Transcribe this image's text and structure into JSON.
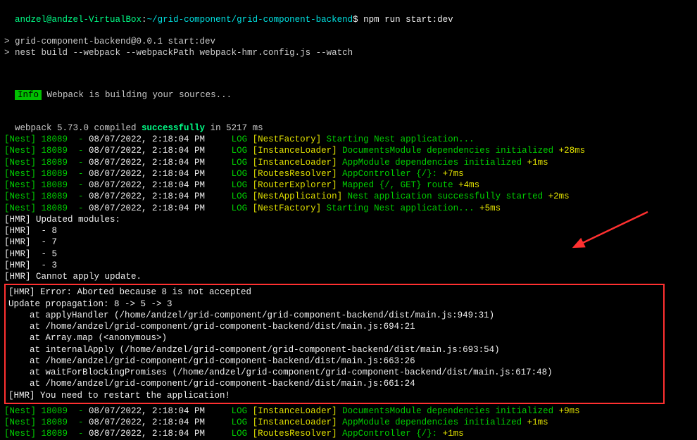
{
  "prompt": {
    "user": "andzel@andzel-VirtualBox",
    "sep": ":",
    "path": "~/grid-component/grid-component-backend",
    "dollar": "$",
    "cmd": "npm run start:dev"
  },
  "npm": [
    "> grid-component-backend@0.0.1 start:dev",
    "> nest build --webpack --webpackPath webpack-hmr.config.js --watch"
  ],
  "infoLabel": "Info",
  "infoMsg": " Webpack is building your sources...",
  "compile_prefix": "webpack 5.73.0 compiled ",
  "compile_success": "successfully",
  "compile_suffix": " in 5217 ms",
  "nestLines": [
    {
      "prefix": "[Nest] 18089  - ",
      "date": "08/07/2022, 2:18:04 PM",
      "log": "     LOG ",
      "tag": "[NestFactory]",
      "msg": " Starting Nest application...",
      "time": ""
    },
    {
      "prefix": "[Nest] 18089  - ",
      "date": "08/07/2022, 2:18:04 PM",
      "log": "     LOG ",
      "tag": "[InstanceLoader]",
      "msg": " DocumentsModule dependencies initialized ",
      "time": "+28ms"
    },
    {
      "prefix": "[Nest] 18089  - ",
      "date": "08/07/2022, 2:18:04 PM",
      "log": "     LOG ",
      "tag": "[InstanceLoader]",
      "msg": " AppModule dependencies initialized ",
      "time": "+1ms"
    },
    {
      "prefix": "[Nest] 18089  - ",
      "date": "08/07/2022, 2:18:04 PM",
      "log": "     LOG ",
      "tag": "[RoutesResolver]",
      "msg": " AppController {/}: ",
      "time": "+7ms"
    },
    {
      "prefix": "[Nest] 18089  - ",
      "date": "08/07/2022, 2:18:04 PM",
      "log": "     LOG ",
      "tag": "[RouterExplorer]",
      "msg": " Mapped {/, GET} route ",
      "time": "+4ms"
    },
    {
      "prefix": "[Nest] 18089  - ",
      "date": "08/07/2022, 2:18:04 PM",
      "log": "     LOG ",
      "tag": "[NestApplication]",
      "msg": " Nest application successfully started ",
      "time": "+2ms"
    },
    {
      "prefix": "[Nest] 18089  - ",
      "date": "08/07/2022, 2:18:04 PM",
      "log": "     LOG ",
      "tag": "[NestFactory]",
      "msg": " Starting Nest application... ",
      "time": "+5ms"
    }
  ],
  "hmrLines": [
    "[HMR] Updated modules:",
    "[HMR]  - 8",
    "[HMR]  - 7",
    "[HMR]  - 5",
    "[HMR]  - 3",
    "[HMR] Cannot apply update."
  ],
  "errorBox": [
    "[HMR] Error: Aborted because 8 is not accepted",
    "Update propagation: 8 -> 5 -> 3",
    "    at applyHandler (/home/andzel/grid-component/grid-component-backend/dist/main.js:949:31)",
    "    at /home/andzel/grid-component/grid-component-backend/dist/main.js:694:21",
    "    at Array.map (<anonymous>)",
    "    at internalApply (/home/andzel/grid-component/grid-component-backend/dist/main.js:693:54)",
    "    at /home/andzel/grid-component/grid-component-backend/dist/main.js:663:26",
    "    at waitForBlockingPromises (/home/andzel/grid-component/grid-component-backend/dist/main.js:617:48)",
    "    at /home/andzel/grid-component/grid-component-backend/dist/main.js:661:24",
    "[HMR] You need to restart the application!"
  ],
  "nestLines2": [
    {
      "prefix": "[Nest] 18089  - ",
      "date": "08/07/2022, 2:18:04 PM",
      "log": "     LOG ",
      "tag": "[InstanceLoader]",
      "msg": " DocumentsModule dependencies initialized ",
      "time": "+9ms"
    },
    {
      "prefix": "[Nest] 18089  - ",
      "date": "08/07/2022, 2:18:04 PM",
      "log": "     LOG ",
      "tag": "[InstanceLoader]",
      "msg": " AppModule dependencies initialized ",
      "time": "+1ms"
    },
    {
      "prefix": "[Nest] 18089  - ",
      "date": "08/07/2022, 2:18:04 PM",
      "log": "     LOG ",
      "tag": "[RoutesResolver]",
      "msg": " AppController {/}: ",
      "time": "+1ms"
    }
  ]
}
